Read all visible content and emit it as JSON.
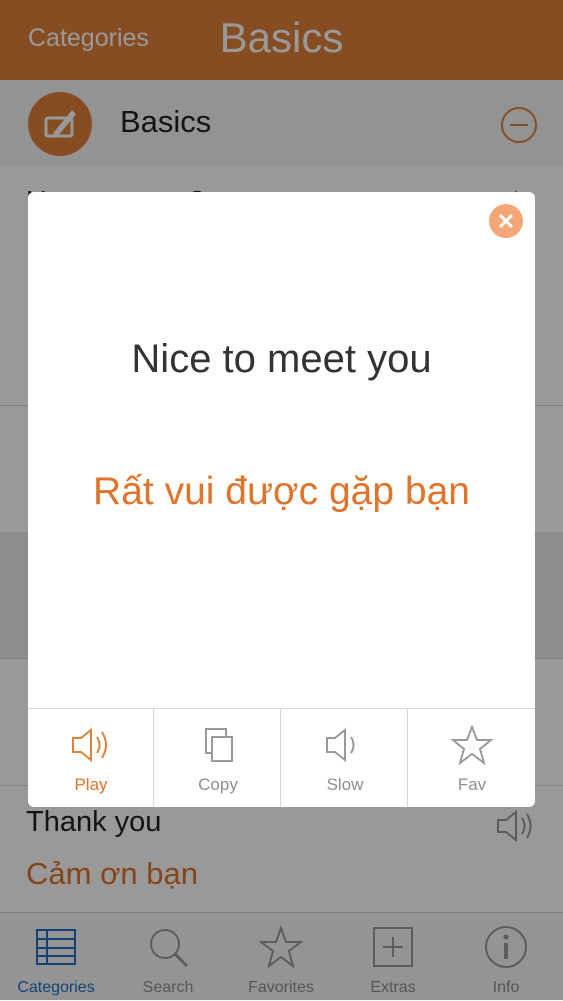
{
  "navbar": {
    "back_label": "Categories",
    "title": "Basics"
  },
  "category": {
    "title": "Basics",
    "icon": "pencil-book-icon",
    "action_icon": "minus-circle-icon"
  },
  "list": {
    "rows": [
      {
        "en": "How are you?",
        "vi": "",
        "visible": "partial"
      },
      {
        "en": "",
        "vi": "",
        "visible": "covered"
      },
      {
        "en": "",
        "vi": "",
        "visible": "covered"
      },
      {
        "en": "",
        "vi": "",
        "visible": "covered"
      },
      {
        "en": "",
        "vi": "",
        "visible": "covered"
      },
      {
        "en": "Thank you",
        "vi": "Cảm ơn bạn",
        "visible": "full"
      }
    ]
  },
  "modal": {
    "english": "Nice to meet you",
    "vietnamese": "Rất vui được gặp bạn",
    "close_icon": "close-icon",
    "actions": [
      {
        "label": "Play",
        "icon": "speaker-icon",
        "active": true
      },
      {
        "label": "Copy",
        "icon": "copy-icon",
        "active": false
      },
      {
        "label": "Slow",
        "icon": "speaker-slow-icon",
        "active": false
      },
      {
        "label": "Fav",
        "icon": "star-icon",
        "active": false
      }
    ]
  },
  "tabbar": {
    "tabs": [
      {
        "label": "Categories",
        "icon": "list-grid-icon",
        "active": true
      },
      {
        "label": "Search",
        "icon": "search-icon",
        "active": false
      },
      {
        "label": "Favorites",
        "icon": "star-icon",
        "active": false
      },
      {
        "label": "Extras",
        "icon": "plus-square-icon",
        "active": false
      },
      {
        "label": "Info",
        "icon": "info-icon",
        "active": false
      }
    ]
  },
  "colors": {
    "brand_orange": "#e0813a",
    "text_orange": "#e0742a",
    "active_blue": "#1f6fc8"
  }
}
